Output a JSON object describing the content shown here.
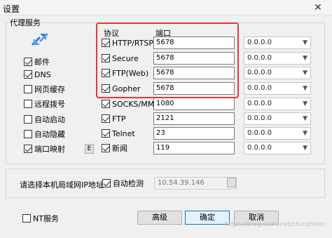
{
  "window": {
    "title": "设置",
    "close_glyph": "✕"
  },
  "proxy_group": {
    "title": "代理服务"
  },
  "left_options": [
    {
      "label": "邮件",
      "checked": true
    },
    {
      "label": "DNS",
      "checked": true
    },
    {
      "label": "网页缓存",
      "checked": false
    },
    {
      "label": "远程拨号",
      "checked": false
    },
    {
      "label": "自动启动",
      "checked": false
    },
    {
      "label": "自动隐藏",
      "checked": false
    },
    {
      "label": "端口映射",
      "checked": true
    }
  ],
  "port_map_button": "E",
  "headers": {
    "protocol": "协议",
    "port": "端口"
  },
  "protocols": [
    {
      "label": "HTTP/RTSP",
      "checked": true,
      "port": "5678",
      "ip": "0.0.0.0"
    },
    {
      "label": "Secure",
      "checked": true,
      "port": "5678",
      "ip": "0.0.0.0"
    },
    {
      "label": "FTP(Web)",
      "checked": true,
      "port": "5678",
      "ip": "0.0.0.0"
    },
    {
      "label": "Gopher",
      "checked": true,
      "port": "5678",
      "ip": "0.0.0.0"
    },
    {
      "label": "SOCKS/MMS",
      "checked": true,
      "port": "1080",
      "ip": "0.0.0.0"
    },
    {
      "label": "FTP",
      "checked": true,
      "port": "2121",
      "ip": "0.0.0.0"
    },
    {
      "label": "Telnet",
      "checked": true,
      "port": "23",
      "ip": "0.0.0.0"
    },
    {
      "label": "新闻",
      "checked": true,
      "port": "119",
      "ip": "0.0.0.0"
    }
  ],
  "lan_ip": {
    "label": "请选择本机局域网IP地址:",
    "auto_detect_label": "自动检测",
    "auto_detect_checked": true,
    "ip_value": "10.54.39.146"
  },
  "nt_service": {
    "label": "NT服务",
    "checked": false
  },
  "buttons": {
    "advanced": "高级",
    "ok": "确定",
    "cancel": "取消"
  },
  "watermark": "https://blog.csdn.net/chizizhixin",
  "colors": {
    "highlight": "#e03a3a",
    "primary_border": "#0078d7"
  },
  "icons": {
    "proxy_logo": "network-arrows-icon"
  }
}
